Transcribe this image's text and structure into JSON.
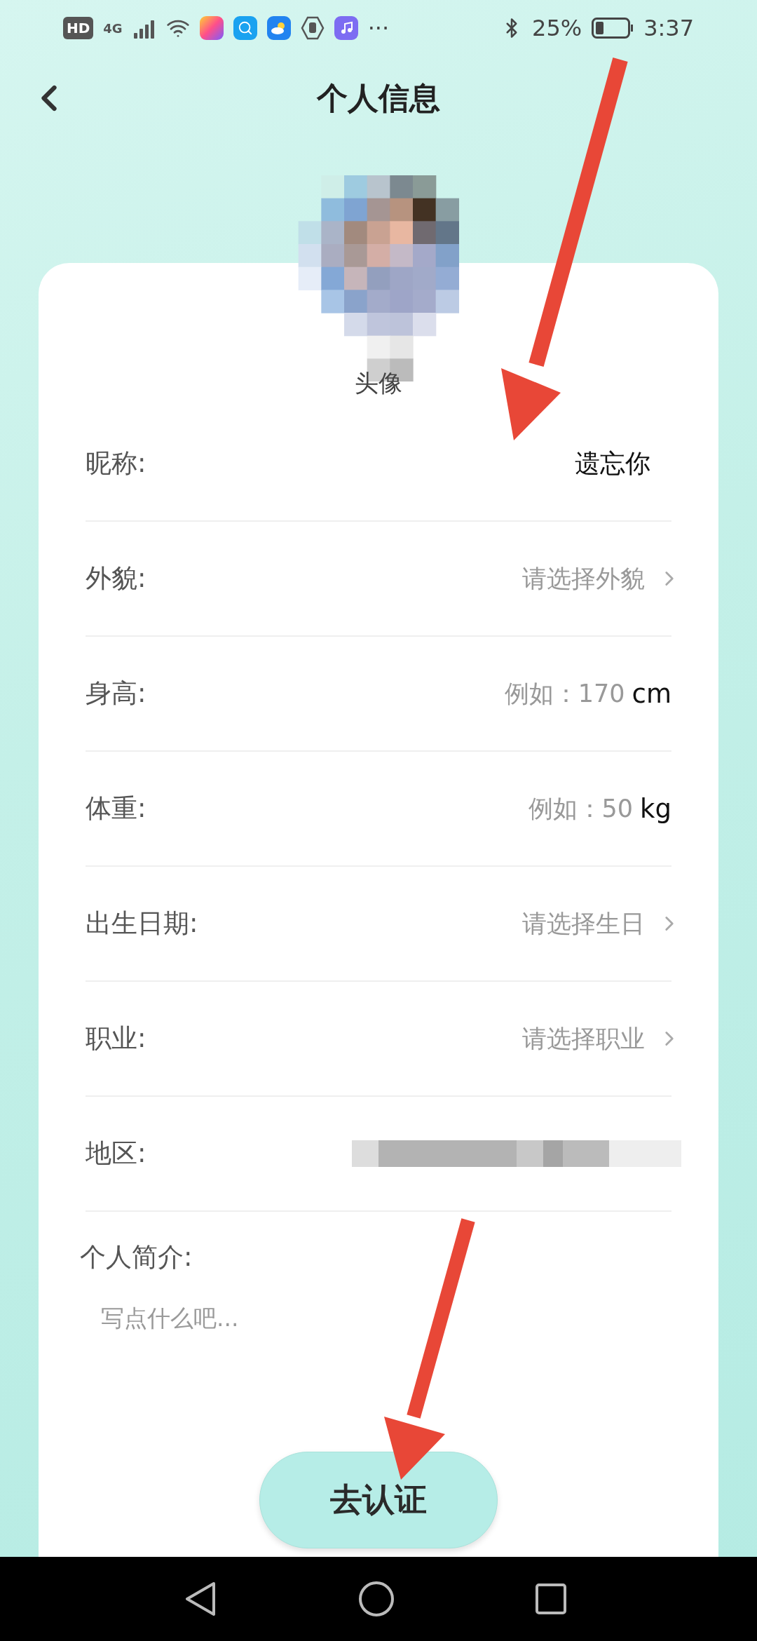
{
  "status_bar": {
    "badge": "HD",
    "network": "4G",
    "more": "···",
    "battery": "25%",
    "time": "3:37"
  },
  "header": {
    "title": "个人信息"
  },
  "avatar": {
    "label": "头像"
  },
  "fields": [
    {
      "kind": "text",
      "label": "昵称:",
      "value": "遗忘你"
    },
    {
      "kind": "select",
      "label": "外貌:",
      "placeholder": "请选择外貌"
    },
    {
      "kind": "input",
      "label": "身高:",
      "placeholder": "例如：170",
      "unit": "cm"
    },
    {
      "kind": "input",
      "label": "体重:",
      "placeholder": "例如：50",
      "unit": "kg"
    },
    {
      "kind": "select",
      "label": "出生日期:",
      "placeholder": "请选择生日"
    },
    {
      "kind": "select",
      "label": "职业:",
      "placeholder": "请选择职业"
    },
    {
      "kind": "redacted",
      "label": "地区:"
    }
  ],
  "bio": {
    "label": "个人简介:",
    "placeholder": "写点什么吧..."
  },
  "submit_button": "去认证"
}
